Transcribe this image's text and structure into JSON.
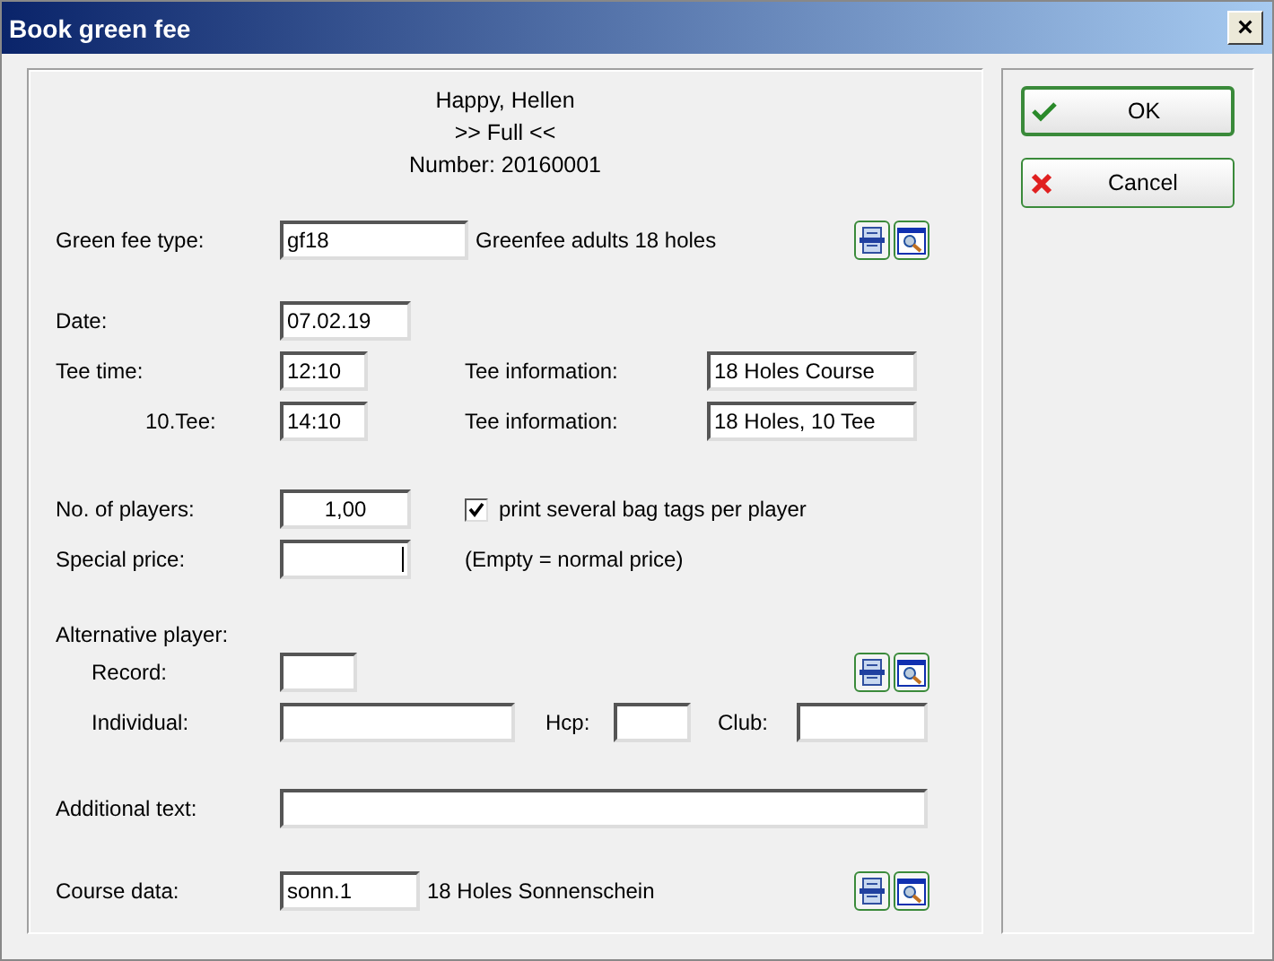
{
  "window": {
    "title": "Book green fee",
    "close": "×"
  },
  "header": [
    "Happy, Hellen",
    ">> Full <<",
    "Number: 20160001"
  ],
  "green_fee_type": {
    "label": "Green fee type:",
    "value": "gf18",
    "description": "Greenfee adults 18 holes"
  },
  "date": {
    "label": "Date:",
    "value": "07.02.19"
  },
  "tee_times": [
    {
      "label": "Tee time:",
      "value": "12:10",
      "info_label": "Tee information:",
      "info_value": "18 Holes Course",
      "indented": false
    },
    {
      "label": "10.Tee:",
      "value": "14:10",
      "info_label": "Tee information:",
      "info_value": "18 Holes, 10 Tee",
      "indented": true
    }
  ],
  "players": {
    "label": "No. of players:",
    "value": "1,00"
  },
  "bag_tags": {
    "label": "print several bag tags per player",
    "checked": true
  },
  "special_price": {
    "label": "Special price:",
    "focused": true,
    "hint": "(Empty = normal price)"
  },
  "alternative_player": {
    "heading": "Alternative player:",
    "record": {
      "label": "Record:"
    },
    "individual": {
      "label": "Individual:"
    },
    "hcp": {
      "label": "Hcp:"
    },
    "club": {
      "label": "Club:"
    }
  },
  "additional_text": {
    "label": "Additional text:"
  },
  "course_data": {
    "label": "Course data:",
    "value": "sonn.1",
    "description": "18 Holes Sonnenschein"
  },
  "buttons": [
    {
      "label": "OK",
      "kind": "ok",
      "default": true
    },
    {
      "label": "Cancel",
      "kind": "cancel",
      "default": false
    }
  ]
}
